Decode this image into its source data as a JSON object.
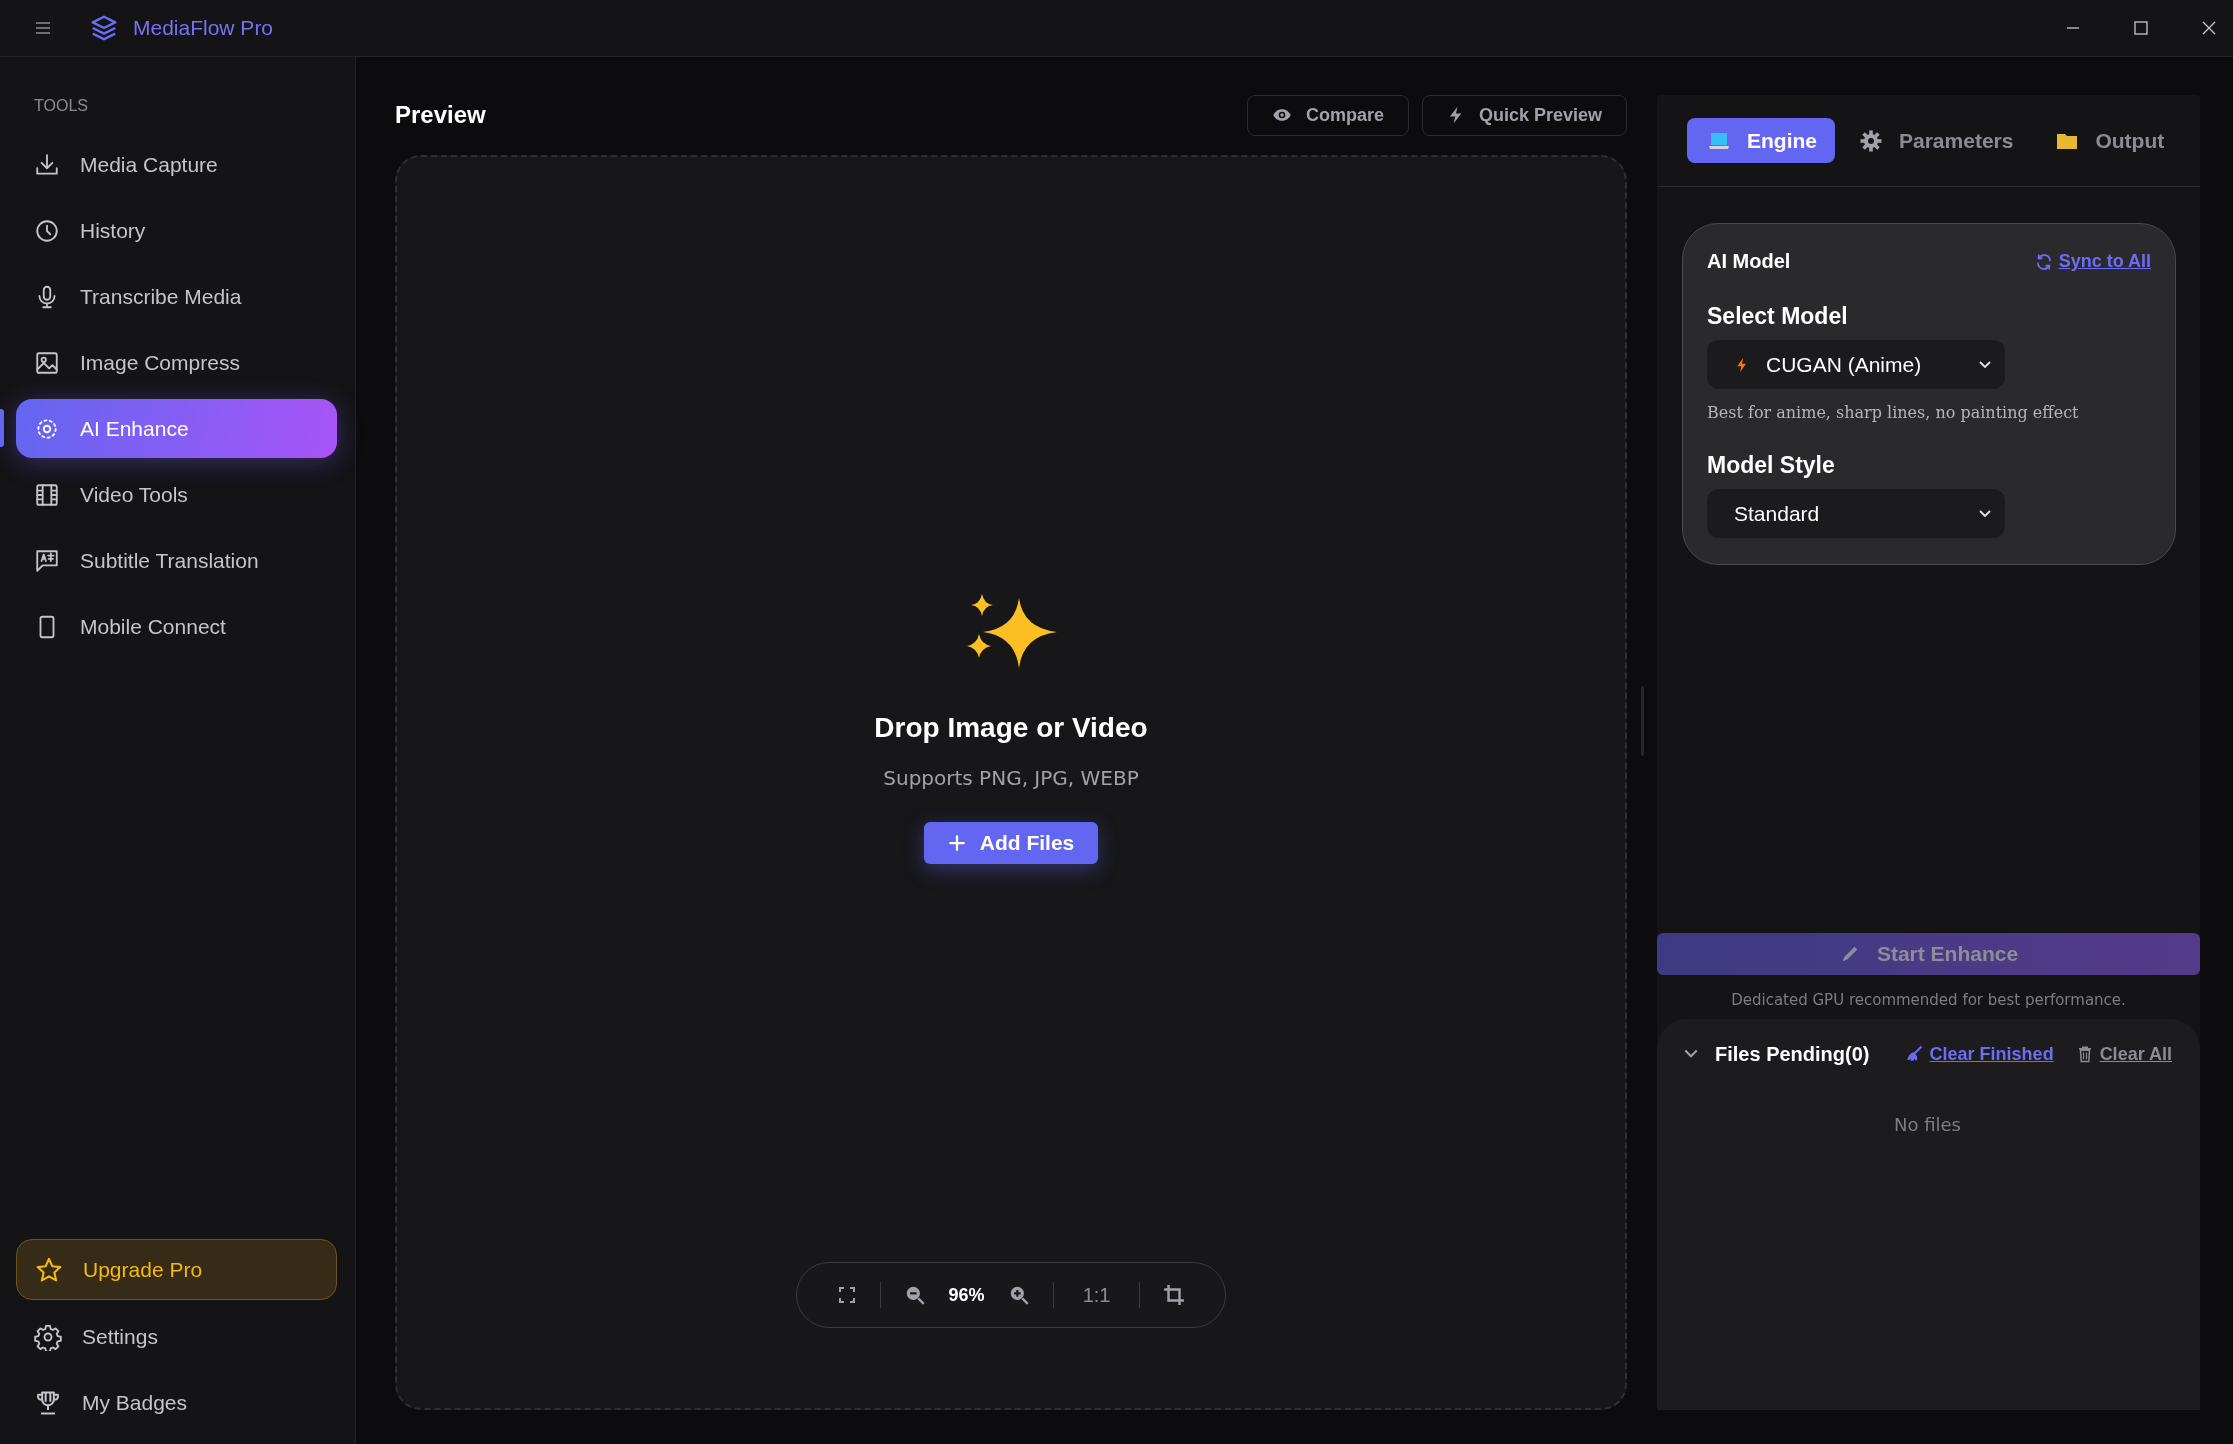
{
  "window": {
    "title": "MediaFlow Pro"
  },
  "sidebar": {
    "section_label": "TOOLS",
    "items": [
      {
        "label": "Media Capture",
        "selected": false
      },
      {
        "label": "History",
        "selected": false
      },
      {
        "label": "Transcribe Media",
        "selected": false
      },
      {
        "label": "Image Compress",
        "selected": false
      },
      {
        "label": "AI Enhance",
        "selected": true
      },
      {
        "label": "Video Tools",
        "selected": false
      },
      {
        "label": "Subtitle Translation",
        "selected": false
      },
      {
        "label": "Mobile Connect",
        "selected": false
      }
    ],
    "footer_items": [
      {
        "label": "Upgrade Pro",
        "kind": "upgrade"
      },
      {
        "label": "Settings",
        "kind": "settings"
      },
      {
        "label": "My Badges",
        "kind": "badges"
      }
    ]
  },
  "preview": {
    "title": "Preview",
    "compare_button": "Compare",
    "quick_preview_button": "Quick Preview",
    "drop_title": "Drop Image or Video",
    "drop_hint": "Supports PNG, JPG, WEBP",
    "add_button": "Add Files",
    "zoom_level": "96%",
    "ratio_button": "1:1"
  },
  "right_panel": {
    "tabs": [
      {
        "label": "Engine",
        "selected": true
      },
      {
        "label": "Parameters",
        "selected": false
      },
      {
        "label": "Output",
        "selected": false
      }
    ],
    "card": {
      "title": "AI Model",
      "sync_link": "Sync to All",
      "select_model_label": "Select Model",
      "model_value": "CUGAN (Anime)",
      "model_description": "Best for anime, sharp lines, no painting effect",
      "style_label": "Model Style",
      "style_value": "Standard"
    },
    "start_button": {
      "label": "Start Enhance",
      "disabled": true
    },
    "gpu_note": "Dedicated GPU recommended for best performance.",
    "files": {
      "title": "Files Pending(0)",
      "expanded": true,
      "clear_finished": "Clear Finished",
      "clear_all": "Clear All",
      "empty_text": "No files"
    }
  }
}
